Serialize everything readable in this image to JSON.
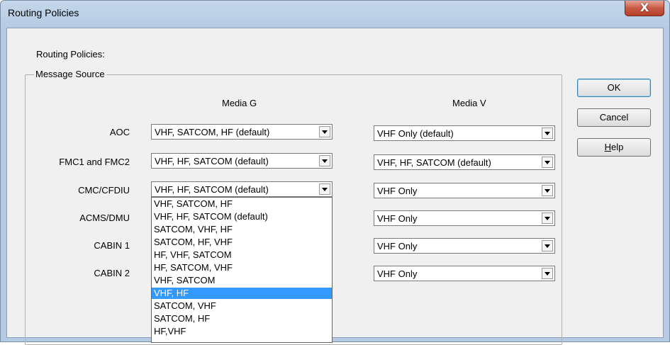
{
  "window": {
    "title": "Routing Policies",
    "close_glyph": "X"
  },
  "dialog": {
    "heading": "Routing Policies:",
    "group_label": "Message Source",
    "columns": {
      "media_g": "Media G",
      "media_v": "Media V"
    },
    "rows": [
      {
        "label": "AOC",
        "media_g": "VHF, SATCOM, HF (default)",
        "media_v": "VHF Only (default)"
      },
      {
        "label": "FMC1 and FMC2",
        "media_g": "VHF, HF, SATCOM (default)",
        "media_v": "VHF, HF, SATCOM (default)"
      },
      {
        "label": "CMC/CFDIU",
        "media_g": "VHF, HF, SATCOM (default)",
        "media_v": "VHF Only"
      },
      {
        "label": "ACMS/DMU",
        "media_g": "",
        "media_v": "VHF Only"
      },
      {
        "label": "CABIN 1",
        "media_g": "",
        "media_v": "VHF Only"
      },
      {
        "label": "CABIN 2",
        "media_g": "",
        "media_v": "VHF Only"
      }
    ],
    "buttons": {
      "ok": "OK",
      "cancel": "Cancel",
      "help_mnemonic": "H",
      "help_rest": "elp"
    },
    "dropdown": {
      "open_for": "CMC/CFDIU",
      "options": [
        "VHF, SATCOM, HF",
        "VHF, HF, SATCOM (default)",
        "SATCOM, VHF, HF",
        "SATCOM, HF, VHF",
        "HF, VHF, SATCOM",
        "HF, SATCOM, VHF",
        "VHF, SATCOM",
        "VHF, HF",
        "SATCOM, VHF",
        "SATCOM, HF",
        "HF,VHF"
      ],
      "highlighted_index": 7
    }
  },
  "colors": {
    "selection": "#3399ff",
    "close_button": "#c75a44",
    "title_bar": "#b6cbe3"
  }
}
